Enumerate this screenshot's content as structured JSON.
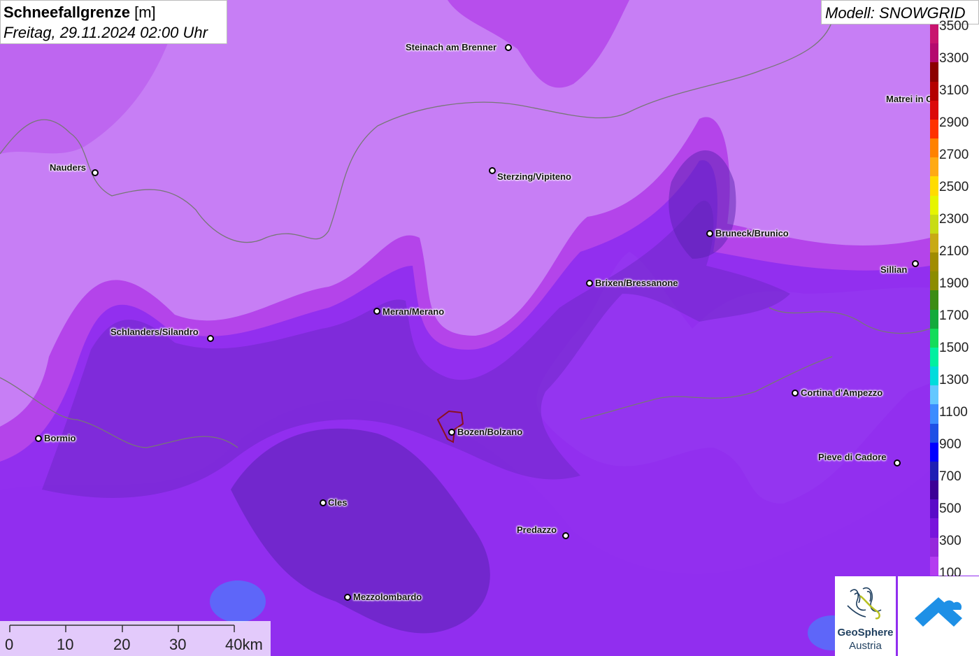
{
  "header": {
    "title": "Schneefallgrenze",
    "unit": "[m]",
    "datetime": "Freitag, 29.11.2024 02:00 Uhr"
  },
  "model": {
    "label": "Modell: SNOWGRID"
  },
  "cities": [
    {
      "name": "Steinach am Brenner",
      "id": "steinach"
    },
    {
      "name": "Nauders",
      "id": "nauders"
    },
    {
      "name": "Sterzing/Vipiteno",
      "id": "sterzing"
    },
    {
      "name": "Matrei in Osttirol",
      "id": "matrei"
    },
    {
      "name": "Bruneck/Brunico",
      "id": "bruneck"
    },
    {
      "name": "Sillian",
      "id": "sillian"
    },
    {
      "name": "Brixen/Bressanone",
      "id": "brixen"
    },
    {
      "name": "Meran/Merano",
      "id": "meran"
    },
    {
      "name": "Schlanders/Silandro",
      "id": "schlanders"
    },
    {
      "name": "Cortina d'Ampezzo",
      "id": "cortina"
    },
    {
      "name": "Bormio",
      "id": "bormio"
    },
    {
      "name": "Bozen/Bolzano",
      "id": "bozen"
    },
    {
      "name": "Pieve di Cadore",
      "id": "pieve"
    },
    {
      "name": "Cles",
      "id": "cles"
    },
    {
      "name": "Predazzo",
      "id": "predazzo"
    },
    {
      "name": "Mezzolombardo",
      "id": "mezzolombardo"
    }
  ],
  "legend": {
    "labels": [
      "3500",
      "3300",
      "3100",
      "2900",
      "2700",
      "2500",
      "2300",
      "2100",
      "1900",
      "1700",
      "1500",
      "1300",
      "1100",
      "900",
      "700",
      "500",
      "300",
      "100"
    ],
    "colors": [
      "#c8146e",
      "#b40a6e",
      "#8c0000",
      "#b40000",
      "#dc0a0a",
      "#ff3200",
      "#ff8200",
      "#ffaa14",
      "#ffdc00",
      "#e6f500",
      "#c8dc14",
      "#c8aa14",
      "#a08c00",
      "#8c8c00",
      "#3c8c14",
      "#14aa3c",
      "#14dc5a",
      "#00f0a0",
      "#00dcdc",
      "#64c8ff",
      "#3c8cff",
      "#1e50e6",
      "#0000ff",
      "#1e1eb4",
      "#3c0096",
      "#5a0ac8",
      "#7814dc",
      "#9628dc",
      "#b43cf0"
    ]
  },
  "scale": {
    "ticks": [
      "0",
      "10",
      "20",
      "30",
      "40km"
    ]
  },
  "logo": {
    "brand_line1": "GeoSphere",
    "brand_line2": "Austria"
  },
  "colors": {
    "bg_light": "#c77ef5",
    "band_magenta": "#b03ae8",
    "band_purple": "#8e2ef0",
    "band_dark": "#6f28c8",
    "band_deep": "#5a22b0",
    "app_logo_blue": "#1e90e6"
  }
}
